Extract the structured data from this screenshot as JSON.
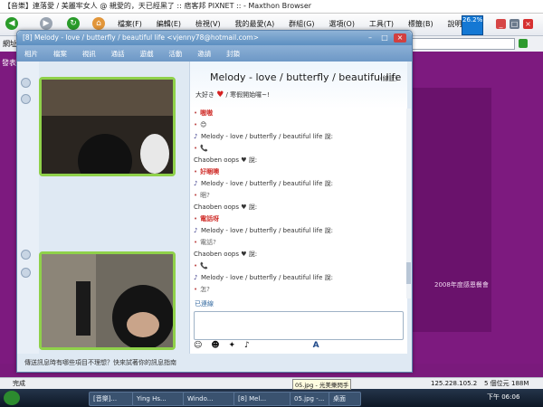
{
  "browser": {
    "title": "【音樂】連落愛 / 美麗牢女人 @ 親愛的，天已經黑了 :: 痞客邦 PIXNET :: - Maxthon Browser",
    "menu": [
      "檔案(F)",
      "編輯(E)",
      "檢視(V)",
      "我的最愛(A)",
      "群組(G)",
      "選項(O)",
      "工具(T)",
      "標籤(B)",
      "說明(H)"
    ],
    "netmeter": "26.2%",
    "address_label": "網址",
    "tab_label": "發表",
    "page_caption": "2008年度感恩餐會",
    "status_left": "完成",
    "status_ip": "125.228.105.2",
    "status_mode": "5 個位元",
    "status_mem": "188M",
    "status_extra": "3"
  },
  "messenger": {
    "window_title": "[8] Melody - love / butterfly / beautiful life <vjenny78@hotmail.com>",
    "menu": [
      "相片",
      "檔案",
      "視訊",
      "通話",
      "遊戲",
      "活動",
      "邀請",
      "封鎖"
    ],
    "contact_name": "Melody - love / butterfly / beautiful life",
    "contact_status": "(線上)",
    "personal_message_prefix": "大好き",
    "personal_message_suffix": "/  寒假開始囉~!",
    "messages": [
      {
        "kind": "text-red",
        "text": "嗷嗷"
      },
      {
        "kind": "emoji",
        "text": "😊"
      },
      {
        "kind": "sender",
        "text": "Melody - love / butterfly / beautiful life 說:"
      },
      {
        "kind": "emoji",
        "text": "📞"
      },
      {
        "kind": "sender-them",
        "text": "Chaoben oops ♥ 說:"
      },
      {
        "kind": "text-red",
        "text": "好睏噢"
      },
      {
        "kind": "sender",
        "text": "Melody - love / butterfly / beautiful life 說:"
      },
      {
        "kind": "text-grey",
        "text": "睏?"
      },
      {
        "kind": "sender-them",
        "text": "Chaoben oops ♥ 說:"
      },
      {
        "kind": "text-red",
        "text": "電話呀"
      },
      {
        "kind": "sender",
        "text": "Melody - love / butterfly / beautiful life 說:"
      },
      {
        "kind": "text-grey",
        "text": "電話?"
      },
      {
        "kind": "sender-them",
        "text": "Chaoben oops ♥ 說:"
      },
      {
        "kind": "emoji",
        "text": "📞"
      },
      {
        "kind": "sender",
        "text": "Melody - love / butterfly / beautiful life 說:"
      },
      {
        "kind": "text-grey",
        "text": "怎?"
      }
    ],
    "blocked_label": "已連線",
    "status_text": "傳送訊息時有哪些項目不理想？快來試著你的訊息指南"
  },
  "taskbar": {
    "items": [
      "[音樂]...",
      "Ying Hs...",
      "Windo...",
      "[8] Mel...",
      "05.jpg -..."
    ],
    "tooltip": "05.jpg - 光美樂閃手",
    "desktop_label": "桌面",
    "clock": "下午 06:06"
  },
  "colors": {
    "page_bg": "#7a1a7c",
    "cam_border": "#8fd14a",
    "accent": "#5c8fc1"
  }
}
